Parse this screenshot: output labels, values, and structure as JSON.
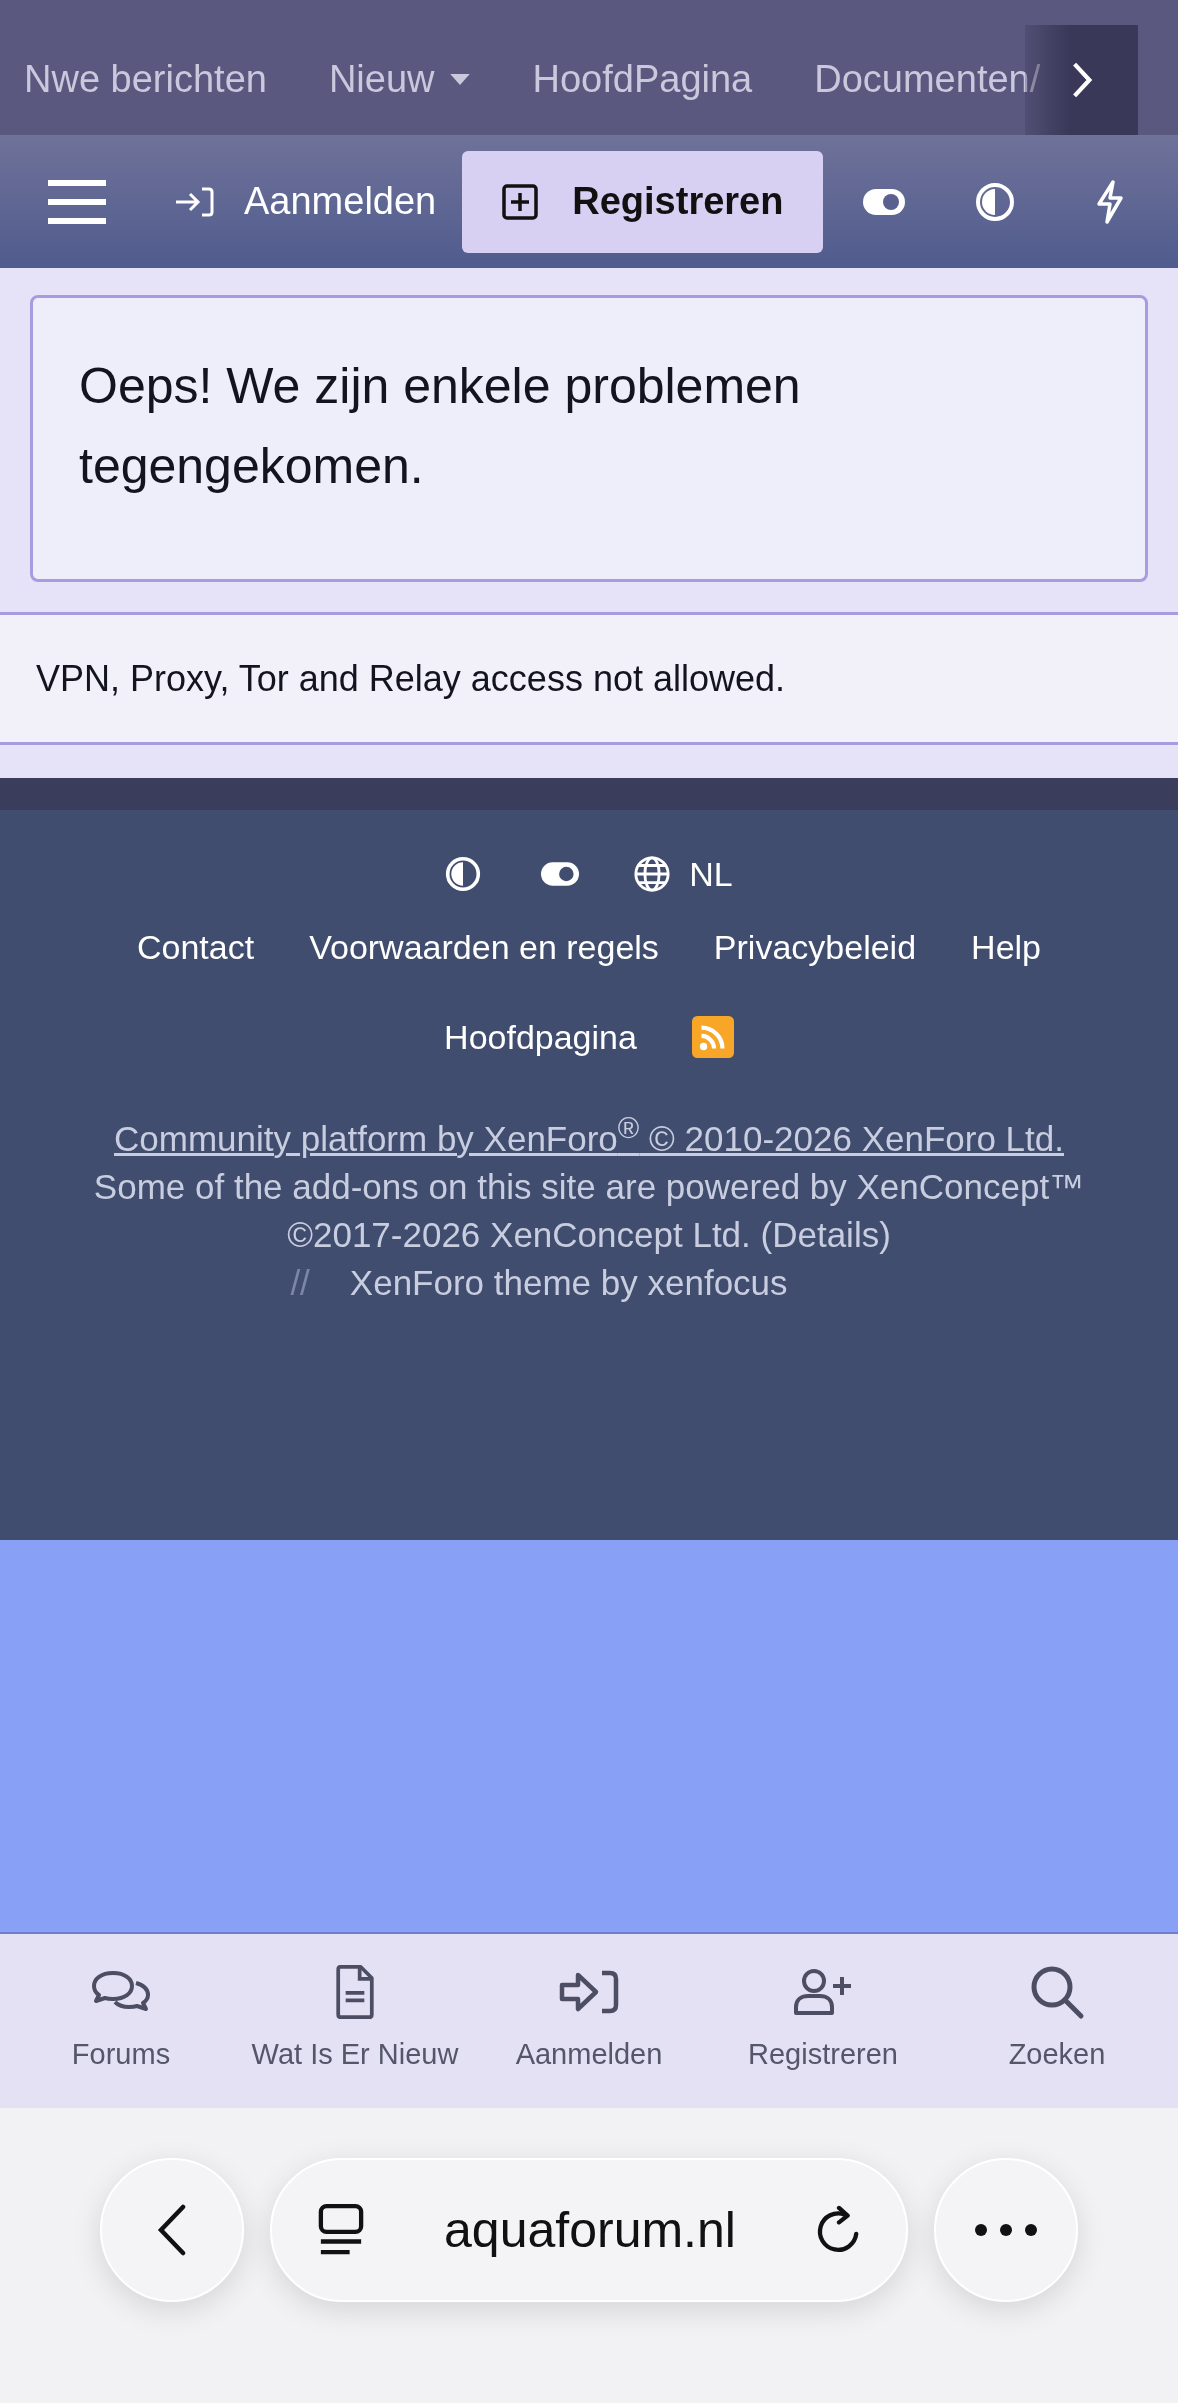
{
  "top_nav": {
    "items": [
      {
        "label": "Nwe berichten",
        "kind": "link"
      },
      {
        "label": "Nieuw",
        "kind": "dropdown"
      },
      {
        "label": "HoofdPagina",
        "kind": "link"
      },
      {
        "label": "Documenten/",
        "kind": "link"
      }
    ]
  },
  "nav_bar": {
    "login": "Aanmelden",
    "register": "Registreren"
  },
  "error": {
    "title": "Oeps! We zijn enkele problemen tegengekomen.",
    "message": "VPN, Proxy, Tor and Relay access not allowed."
  },
  "footer": {
    "language": "NL",
    "links": [
      "Contact",
      "Voorwaarden en regels",
      "Privacybeleid",
      "Help"
    ],
    "home": "Hoofdpagina",
    "copyright": "Community platform by XenForo$^{®}$ © 2010-2026 XenForo Ltd.",
    "addons": "Some of the add-ons on this site are powered by XenConcept™",
    "addons_2": "©2017-2026 XenConcept Ltd. (Details)",
    "separator": "//",
    "theme": "XenForo theme by xenfocus"
  },
  "tab_bar": [
    {
      "label": "Forums"
    },
    {
      "label": "Wat Is Er Nieuw"
    },
    {
      "label": "Aanmelden"
    },
    {
      "label": "Registreren"
    },
    {
      "label": "Zoeken"
    }
  ],
  "browser": {
    "url": "aquaforum.nl"
  }
}
